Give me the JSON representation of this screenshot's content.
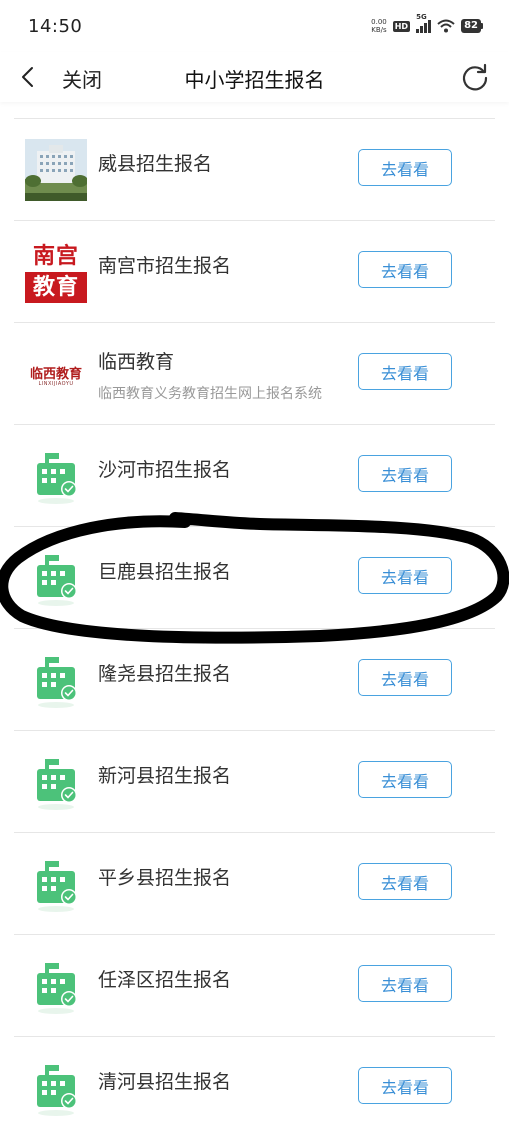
{
  "status_bar": {
    "time": "14:50",
    "net_speed_value": "0.00",
    "net_speed_unit": "KB/s",
    "hd": "HD",
    "signal_label": "5G",
    "battery": "82"
  },
  "nav": {
    "close_label": "关闭",
    "title": "中小学招生报名"
  },
  "button_label": "去看看",
  "items": [
    {
      "title": "威县招生报名",
      "icon": "building-photo-thumbnail"
    },
    {
      "title": "南宫市招生报名",
      "icon": "nangong-education-logo",
      "logo_top": "南宫",
      "logo_bottom": "教育"
    },
    {
      "title": "临西教育",
      "subtitle": "临西教育义务教育招生网上报名系统",
      "icon": "linxi-education-logo",
      "logo_text": "临西教育",
      "logo_sub": "LINXIJIAOYU"
    },
    {
      "title": "沙河市招生报名",
      "icon": "school-icon"
    },
    {
      "title": "巨鹿县招生报名",
      "icon": "school-icon"
    },
    {
      "title": "隆尧县招生报名",
      "icon": "school-icon"
    },
    {
      "title": "新河县招生报名",
      "icon": "school-icon"
    },
    {
      "title": "平乡县招生报名",
      "icon": "school-icon"
    },
    {
      "title": "任泽区招生报名",
      "icon": "school-icon"
    },
    {
      "title": "清河县招生报名",
      "icon": "school-icon"
    }
  ],
  "colors": {
    "button_border": "#4aa3e0",
    "button_text": "#3a8fd6",
    "school_icon_green": "#4cc27a",
    "nangong_red": "#c8191f",
    "divider": "#e6e6e6"
  }
}
